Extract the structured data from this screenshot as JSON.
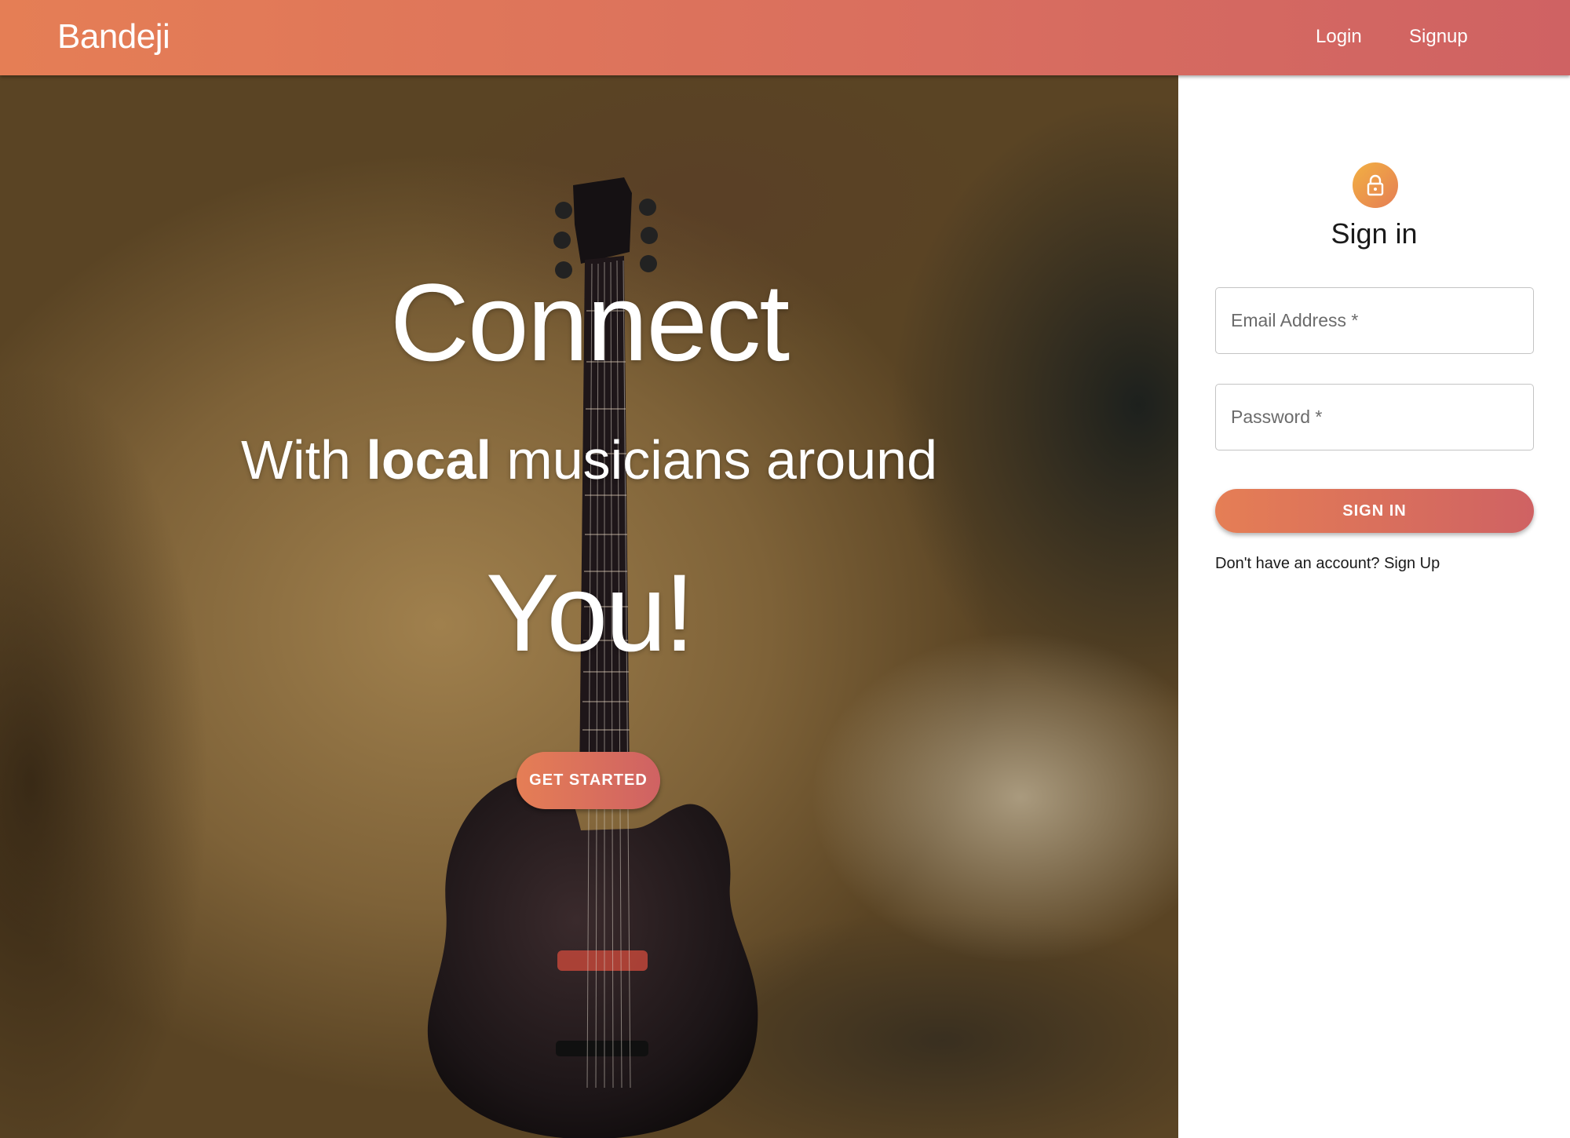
{
  "appbar": {
    "brand": "Bandeji",
    "nav": {
      "login": "Login",
      "signup": "Signup"
    }
  },
  "hero": {
    "title": "Connect",
    "subtitle_prefix": "With ",
    "subtitle_bold": "local",
    "subtitle_suffix": " musicians around",
    "emphasis": "You!",
    "cta_label": "GET STARTED",
    "background_image": "guitar-on-textured-background"
  },
  "signin": {
    "icon": "lock-icon",
    "title": "Sign in",
    "email_placeholder": "Email Address *",
    "password_placeholder": "Password *",
    "button_label": "SIGN IN",
    "signup_prompt": "Don't have an account? Sign Up"
  },
  "colors": {
    "gradient_start": "#e57e55",
    "gradient_end": "#cf6263",
    "avatar_start": "#f2b042",
    "text_dark": "#1a1a1a"
  }
}
